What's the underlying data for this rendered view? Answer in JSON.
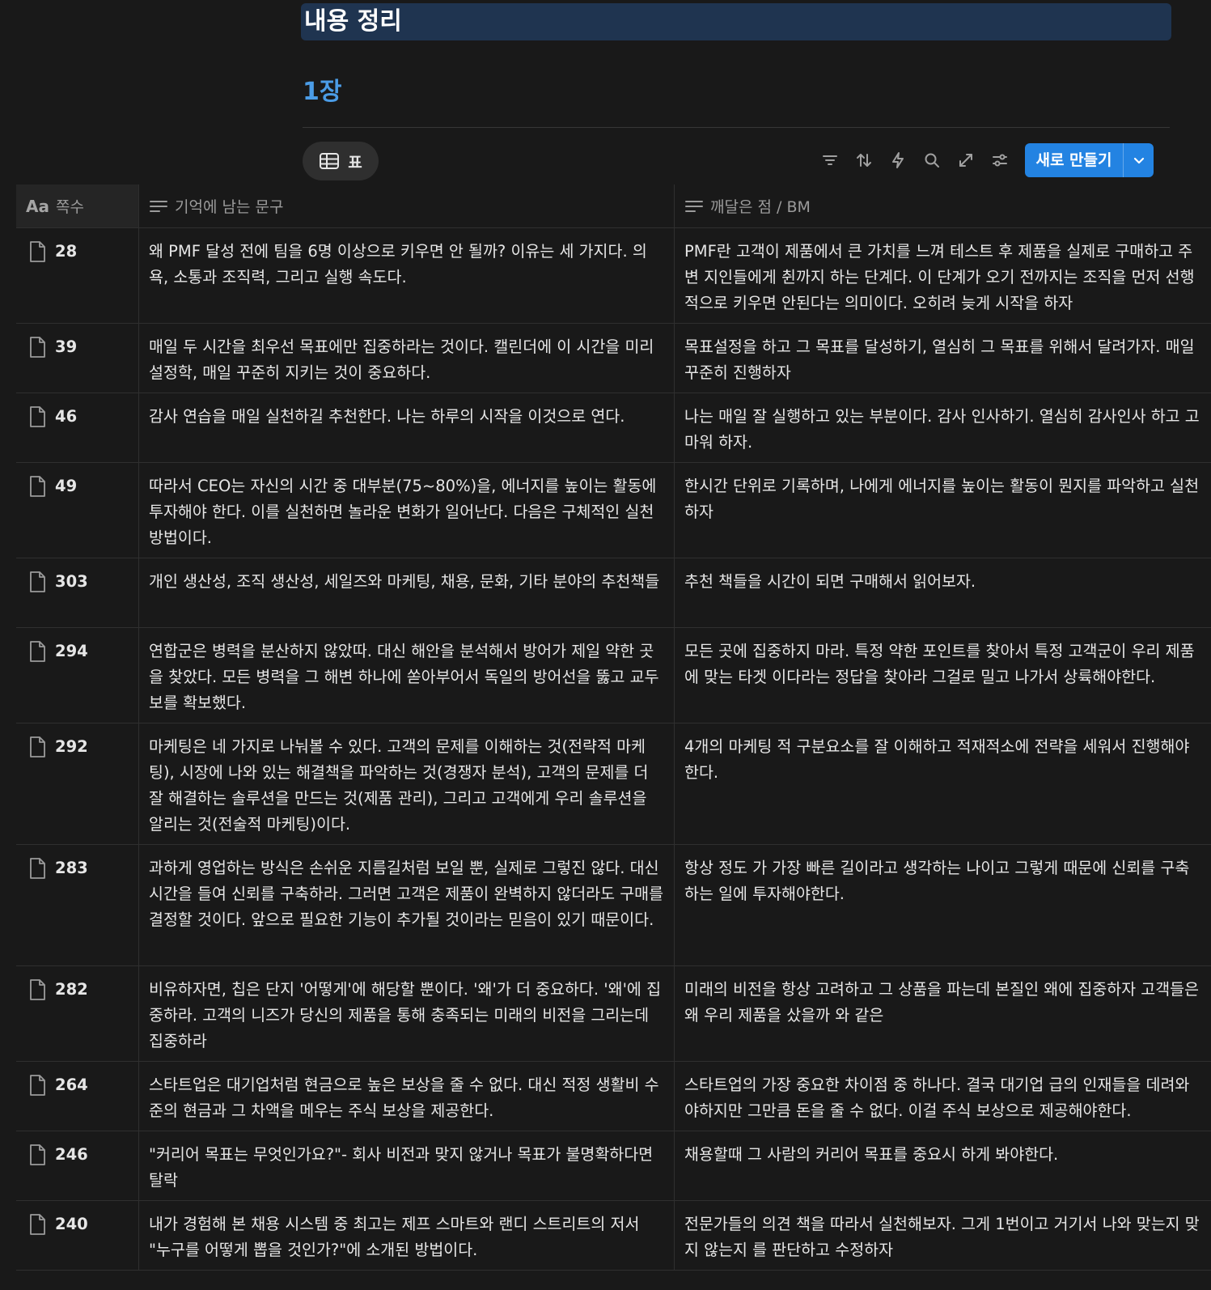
{
  "page": {
    "heading": "내용 정리",
    "chapter": "1장"
  },
  "view": {
    "tab_label": "표",
    "tab_icon": "table-icon"
  },
  "toolbar": {
    "icons": [
      "filter-icon",
      "sort-icon",
      "lightning-icon",
      "search-icon",
      "expand-icon",
      "settings-sliders-icon"
    ],
    "new_button_label": "새로 만들기",
    "accent_color": "#2383e2"
  },
  "table": {
    "columns": [
      {
        "icon": "title-aa-icon",
        "icon_text": "Aa",
        "label": "쪽수"
      },
      {
        "icon": "text-lines-icon",
        "label": "기억에 남는 문구"
      },
      {
        "icon": "text-lines-icon",
        "label": "깨달은 점 / BM"
      }
    ],
    "rows": [
      {
        "page": "28",
        "quote": "왜 PMF 달성 전에 팀을 6명 이상으로 키우면 안 될까? 이유는 세 가지다. 의욕, 소통과 조직력, 그리고 실행 속도다.",
        "insight": "PMF란 고객이 제품에서 큰 가치를 느껴 테스트 후 제품을 실제로 구매하고 주변 지인들에게 췬까지 하는 단계다. 이 단계가 오기 전까지는 조직을 먼저 선행적으로 키우면 안된다는 의미이다. 오히려 늦게 시작을 하자"
      },
      {
        "page": "39",
        "quote": "매일 두 시간을 최우선 목표에만 집중하라는 것이다. 캘린더에 이 시간을 미리 설정학, 매일 꾸준히 지키는 것이 중요하다.",
        "insight": "목표설정을 하고 그 목표를 달성하기,  열심히 그 목표를 위해서 달려가자. 매일 꾸준히 진행하자"
      },
      {
        "page": "46",
        "quote": "감사 연습을 매일 실천하길 추천한다. 나는 하루의 시작을 이것으로 연다.",
        "insight": "나는 매일 잘 실행하고 있는 부분이다. 감사 인사하기. 열심히 감사인사 하고 고마워 하자."
      },
      {
        "page": "49",
        "quote": "따라서 CEO는 자신의 시간 중 대부분(75~80%)을, 에너지를 높이는 활동에 투자해야 한다. 이를 실천하면 놀라운 변화가 일어난다. 다음은 구체적인 실천 방법이다.",
        "insight": "한시간 단위로 기록하며, 나에게 에너지를 높이는 활동이 뭔지를 파악하고 실천하자"
      },
      {
        "page": "303",
        "quote": "개인 생산성, 조직 생산성, 세일즈와 마케팅, 채용, 문화, 기타 분야의 추천책들",
        "insight": "추천 책들을 시간이 되면 구매해서 읽어보자."
      },
      {
        "page": "294",
        "quote": "연합군은 병력을 분산하지 않았따. 대신 해안을 분석해서 방어가 제일 약한 곳을 찾았다. 모든 병력을 그 해변 하나에 쏟아부어서 독일의 방어선을 뚫고 교두보를 확보했다.",
        "insight": "모든 곳에 집중하지 마라. 특정 약한 포인트를 찾아서 특정 고객군이 우리 제품에 맞는 타겟 이다라는 정답을 찾아라 그걸로 밀고 나가서 상륙해야한다."
      },
      {
        "page": "292",
        "quote": "마케팅은 네 가지로 나눠볼 수 있다. 고객의 문제를 이해하는 것(전략적 마케팅), 시장에 나와 있는 해결책을 파악하는 것(경쟁자 분석), 고객의 문제를 더 잘 해결하는 솔루션을 만드는 것(제품 관리), 그리고 고객에게 우리 솔루션을 알리는 것(전술적 마케팅)이다.",
        "insight": "4개의 마케팅 적 구분요소를 잘 이해하고 적재적소에 전략을 세워서 진행해야한다."
      },
      {
        "page": "283",
        "quote": "과하게 영업하는 방식은 손쉬운 지름길처럼 보일 뿐, 실제로 그렇진 않다. 대신 시간을 들여 신뢰를 구축하라. 그러면 고객은 제품이 완벽하지 않더라도 구매를 결정할 것이다. 앞으로 필요한 기능이 추가될 것이라는 믿음이 있기 때문이다.",
        "insight": "항상 정도 가 가장 빠른 길이라고 생각하는 나이고 그렇게 때문에 신뢰를 구축하는 일에 투자해야한다."
      },
      {
        "page": "282",
        "quote": "비유하자면, 칩은 단지 '어떻게'에 해당할 뿐이다. '왜'가 더 중요하다. '왜'에 집중하라. 고객의 니즈가 당신의 제품을 통해 충족되는 미래의 비전을 그리는데 집중하라",
        "insight": "미래의 비전을 항상 고려하고 그 상품을 파는데 본질인 왜에 집중하자 고객들은 왜 우리 제품을 샀을까 와 같은"
      },
      {
        "page": "264",
        "quote": "스타트업은 대기업처럼 현금으로 높은 보상을 줄 수 없다. 대신 적정 생활비 수준의 현금과 그 차액을 메우는 주식 보상을 제공한다.",
        "insight": "스타트업의 가장 중요한 차이점 중 하나다. 결국 대기업 급의 인재들을 데려와야하지만 그만큼 돈을 줄 수 없다. 이걸 주식 보상으로 제공해야한다."
      },
      {
        "page": "246",
        "quote": "\"커리어 목표는 무엇인가요?\"- 회사 비전과 맞지 않거나 목표가 불명확하다면 탈락",
        "insight": "채용할때 그 사람의 커리어 목표를 중요시 하게 봐야한다."
      },
      {
        "page": "240",
        "quote": "내가 경험해 본 채용 시스템 중 최고는 제프 스마트와 랜디 스트리트의 저서 \"누구를 어떻게 뽑을 것인가?\"에 소개된 방법이다.",
        "insight": "전문가들의 의견 책을 따라서 실천해보자. 그게 1번이고 거기서 나와 맞는지 맞지 않는지 를 판단하고 수정하자"
      }
    ]
  }
}
